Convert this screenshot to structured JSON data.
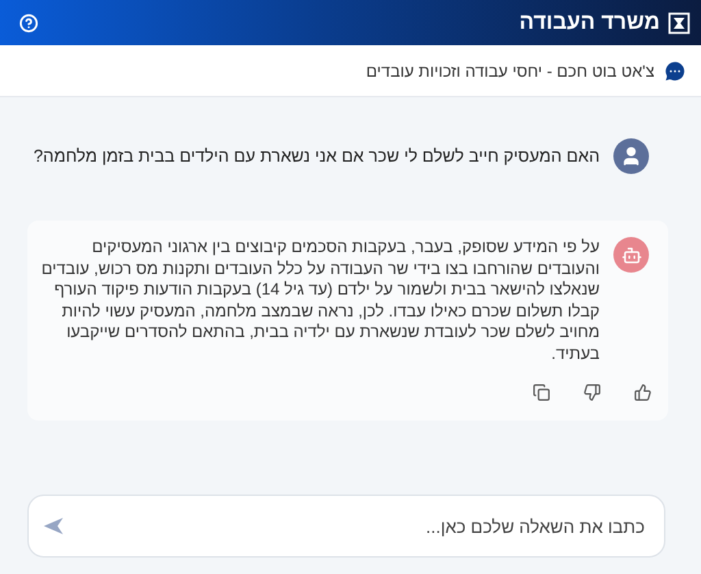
{
  "header": {
    "title": "משרד העבודה"
  },
  "subheader": {
    "title": "צ'אט בוט חכם - יחסי עבודה וזכויות עובדים"
  },
  "messages": [
    {
      "kind": "user",
      "text": "האם המעסיק חייב לשלם לי שכר אם אני נשארת עם הילדים בבית בזמן מלחמה?"
    },
    {
      "kind": "bot",
      "text": "על פי המידע שסופק, בעבר, בעקבות הסכמים קיבוצים בין ארגוני המעסיקים והעובדים שהורחבו בצו בידי שר העבודה על כלל העובדים ותקנות מס רכוש, עובדים שנאלצו להישאר בבית ולשמור על ילדם (עד גיל 14) בעקבות הודעות פיקוד העורף קבלו תשלום שכרם כאילו עבדו. לכן, נראה שבמצב מלחמה, המעסיק עשוי להיות מחויב לשלם שכר לעובדת שנשארת עם ילדיה בבית, בהתאם להסדרים שייקבעו בעתיד."
    }
  ],
  "composer": {
    "placeholder": "כתבו את השאלה שלכם כאן..."
  }
}
